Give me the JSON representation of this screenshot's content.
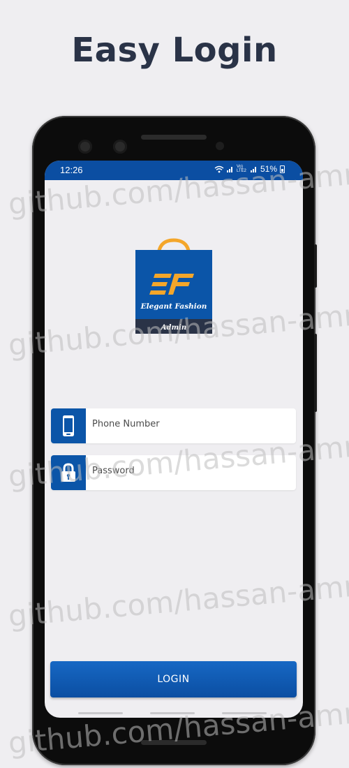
{
  "headline": "Easy Login",
  "status_bar": {
    "time": "12:26",
    "network_label": "Vo) LTE2",
    "battery": "51%"
  },
  "logo": {
    "monogram": "EF",
    "brand": "Elegant Fashion",
    "subtitle": "Admin",
    "colors": {
      "bag": "#0b55a8",
      "accent": "#f4a62a",
      "band": "#2a3347"
    }
  },
  "form": {
    "phone_placeholder": "Phone Number",
    "password_placeholder": "Password",
    "login_label": "LOGIN"
  },
  "icons": {
    "phone_field": "smartphone-icon",
    "password_field": "lock-icon"
  },
  "watermark": "github.com/hassan-amr",
  "colors": {
    "primary": "#0b4ea2",
    "background": "#efeef1",
    "headline": "#2a3347"
  }
}
